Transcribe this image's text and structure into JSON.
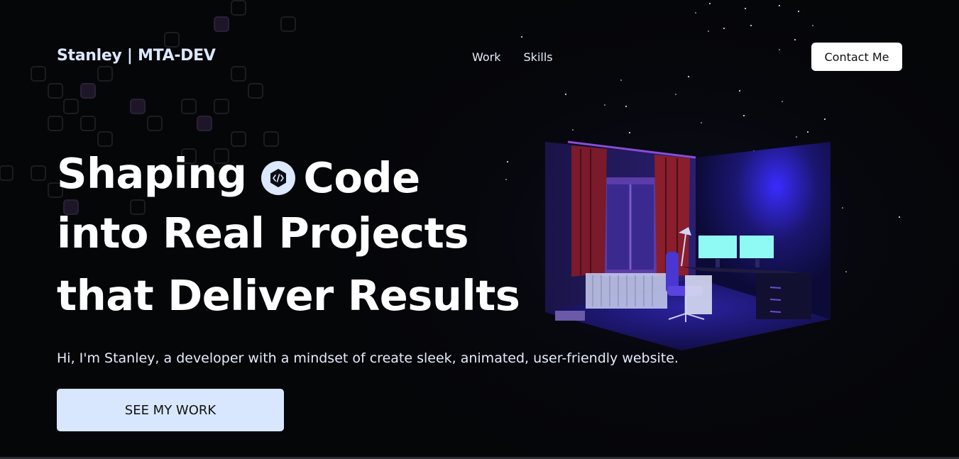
{
  "nav": {
    "logo": "Stanley | MTA-DEV",
    "links": [
      "Work",
      "Skills"
    ],
    "contact_label": "Contact Me"
  },
  "hero": {
    "line1_a": "Shaping",
    "line1_b": "Code",
    "line2": "into Real Projects",
    "line3": "that Deliver Results",
    "subtitle": "Hi, I'm Stanley, a developer with a mindset of create sleek, animated, user-friendly website.",
    "cta_label": "SEE MY WORK"
  },
  "colors": {
    "background": "#050608",
    "accent": "#d8e7fd",
    "logo": "#dbe8ff"
  },
  "icons": {
    "code_badge": "code-icon"
  }
}
